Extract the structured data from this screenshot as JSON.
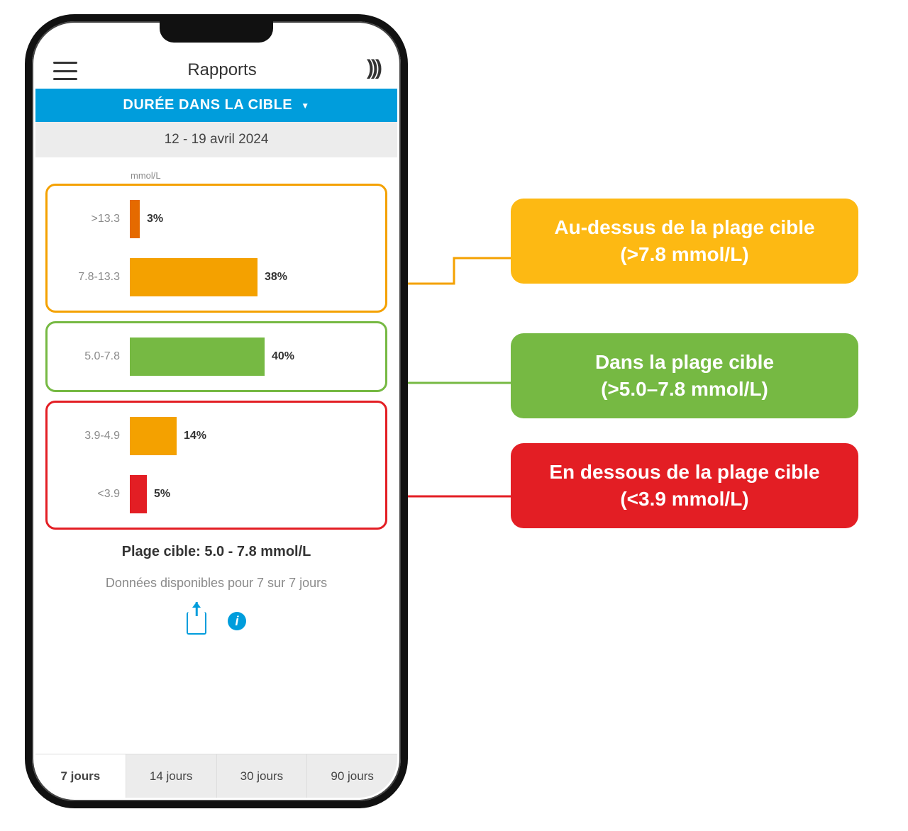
{
  "header": {
    "title": "Rapports"
  },
  "dropdown": {
    "label": "DURÉE DANS LA CIBLE"
  },
  "date_range": "12 - 19 avril 2024",
  "unit_label": "mmol/L",
  "chart_data": {
    "type": "bar",
    "title": "Durée dans la cible",
    "xlabel": "%",
    "ylabel": "mmol/L",
    "ylim": [
      0,
      100
    ],
    "categories": [
      ">13.3",
      "7.8-13.3",
      "5.0-7.8",
      "3.9-4.9",
      "<3.9"
    ],
    "values": [
      3,
      38,
      40,
      14,
      5
    ],
    "series": [
      {
        "name": "Au-dessus de la plage cible",
        "ranges": [
          ">13.3",
          "7.8-13.3"
        ],
        "values": [
          3,
          38
        ]
      },
      {
        "name": "Dans la plage cible",
        "ranges": [
          "5.0-7.8"
        ],
        "values": [
          40
        ]
      },
      {
        "name": "En dessous de la plage cible",
        "ranges": [
          "3.9-4.9",
          "<3.9"
        ],
        "values": [
          14,
          5
        ]
      }
    ]
  },
  "rows": {
    "r0": {
      "label": ">13.3",
      "pct": "3%"
    },
    "r1": {
      "label": "7.8-13.3",
      "pct": "38%"
    },
    "r2": {
      "label": "5.0-7.8",
      "pct": "40%"
    },
    "r3": {
      "label": "3.9-4.9",
      "pct": "14%"
    },
    "r4": {
      "label": "<3.9",
      "pct": "5%"
    }
  },
  "target_text": "Plage cible: 5.0 - 7.8 mmol/L",
  "availability_text": "Données disponibles pour 7 sur 7 jours",
  "tabs": {
    "t7": "7 jours",
    "t14": "14 jours",
    "t30": "30 jours",
    "t90": "90 jours"
  },
  "callouts": {
    "above": {
      "line1": "Au-dessus de la plage cible",
      "line2": "(>7.8 mmol/L)"
    },
    "in": {
      "line1": "Dans la plage cible",
      "line2": "(>5.0–7.8 mmol/L)"
    },
    "below": {
      "line1": "En dessous de la plage cible",
      "line2": "(<3.9 mmol/L)"
    }
  },
  "colors": {
    "blue": "#009ddc",
    "orange_bar": "#f4a100",
    "orange_dark": "#e56a00",
    "green_bar": "#76b943",
    "red_bar": "#e31e24"
  }
}
